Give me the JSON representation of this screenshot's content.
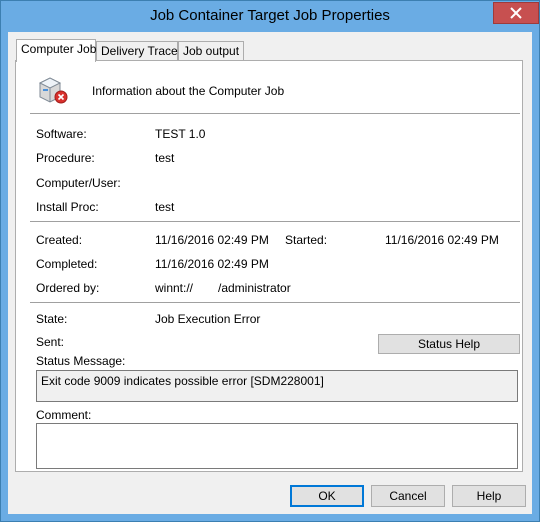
{
  "window": {
    "title": "Job Container Target Job Properties"
  },
  "tabs": [
    {
      "label": "Computer Job"
    },
    {
      "label": "Delivery Trace"
    },
    {
      "label": "Job output"
    }
  ],
  "panel": {
    "header": "Information about the Computer Job",
    "software_label": "Software:",
    "software_value": "TEST 1.0",
    "procedure_label": "Procedure:",
    "procedure_value": "test",
    "computer_label": "Computer/User:",
    "computer_value": "",
    "install_label": "Install Proc:",
    "install_value": "test",
    "created_label": "Created:",
    "created_value": "11/16/2016 02:49 PM",
    "started_label": "Started:",
    "started_value": "11/16/2016 02:49 PM",
    "completed_label": "Completed:",
    "completed_value": "11/16/2016 02:49 PM",
    "ordered_label": "Ordered by:",
    "ordered_value_prefix": "winnt://",
    "ordered_value_suffix": "/administrator",
    "state_label": "State:",
    "state_value": "Job Execution Error",
    "sent_label": "Sent:",
    "status_help_label": "Status Help",
    "status_message_label": "Status Message:",
    "status_message_value": "Exit code 9009 indicates possible error [SDM228001]",
    "comment_label": "Comment:"
  },
  "buttons": {
    "ok": "OK",
    "cancel": "Cancel",
    "help": "Help"
  },
  "colors": {
    "titlebar": "#6aace4",
    "close": "#c75050"
  },
  "icons": {
    "job": "computer-job-error-icon",
    "close": "close-icon"
  }
}
